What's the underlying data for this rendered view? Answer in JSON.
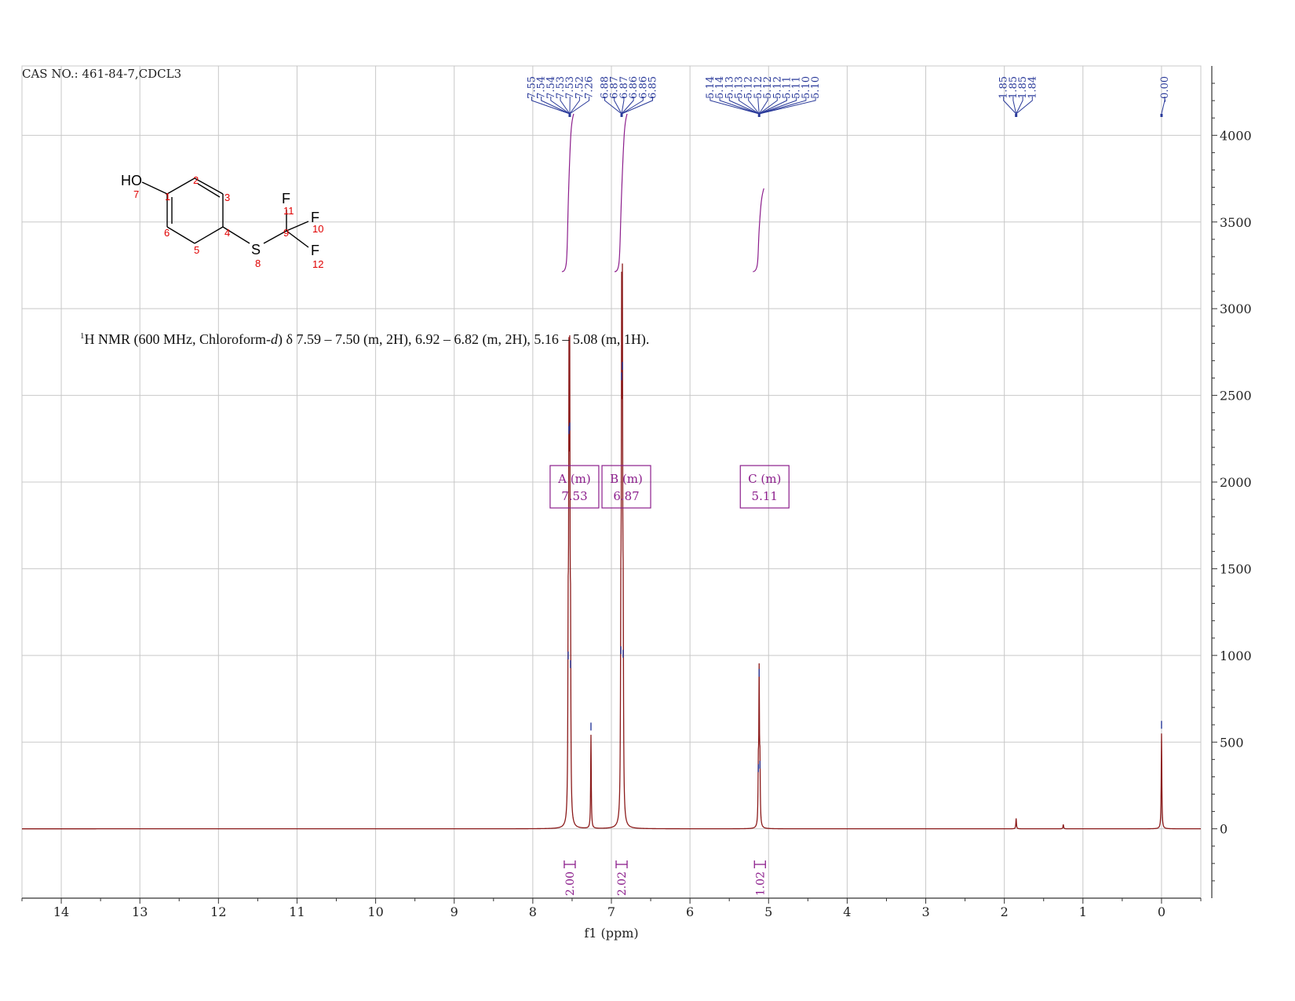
{
  "header": {
    "cas_text": "CAS NO.: 461-84-7,CDCL3",
    "nmr_summary_sup": "1",
    "nmr_summary_a": "H NMR (600 MHz, Chloroform-",
    "nmr_summary_italic": "d",
    "nmr_summary_b": ") δ 7.59 – 7.50 (m, 2H), 6.92 – 6.82 (m, 2H), 5.16 – 5.08 (m, 1H)."
  },
  "structure": {
    "atoms": {
      "ho": "HO",
      "s": "S",
      "f11": "F",
      "f10": "F",
      "f12": "F"
    },
    "numbers": {
      "n1": "1",
      "n2": "2",
      "n3": "3",
      "n4": "4",
      "n5": "5",
      "n6": "6",
      "n7": "7",
      "n8": "8",
      "n9": "9",
      "n10": "10",
      "n11": "11",
      "n12": "12"
    }
  },
  "chart_data": {
    "type": "line",
    "xlabel": "f1 (ppm)",
    "ylabel": "",
    "xlim": [
      14.5,
      -0.5
    ],
    "ylim": [
      -400,
      4400
    ],
    "x_ticks": [
      "14",
      "13",
      "12",
      "11",
      "10",
      "9",
      "8",
      "7",
      "6",
      "5",
      "4",
      "3",
      "2",
      "1",
      "0"
    ],
    "y_ticks": [
      "4000",
      "3500",
      "3000",
      "2500",
      "2000",
      "1500",
      "1000",
      "500",
      "0"
    ],
    "grid": true,
    "colors": {
      "spectrum": "#8b1a1a",
      "peak_labels": "#2a3a9a",
      "integral": "#8c1e8c",
      "grid": "#c8c8c8",
      "axis": "#333333"
    },
    "peaks": [
      {
        "ppm": 7.55,
        "height": 950
      },
      {
        "ppm": 7.54,
        "height": 2250
      },
      {
        "ppm": 7.53,
        "height": 2270
      },
      {
        "ppm": 7.52,
        "height": 900
      },
      {
        "ppm": 7.26,
        "height": 540
      },
      {
        "ppm": 6.88,
        "height": 980
      },
      {
        "ppm": 6.87,
        "height": 2560
      },
      {
        "ppm": 6.86,
        "height": 2620
      },
      {
        "ppm": 6.85,
        "height": 960
      },
      {
        "ppm": 5.12,
        "height": 850
      },
      {
        "ppm": 5.11,
        "height": 320
      },
      {
        "ppm": 5.13,
        "height": 300
      },
      {
        "ppm": 1.85,
        "height": 60
      },
      {
        "ppm": 1.25,
        "height": 25
      },
      {
        "ppm": 0.0,
        "height": 550
      }
    ],
    "peak_label_groups": [
      {
        "labels": [
          "7.55",
          "7.54",
          "7.54",
          "7.53",
          "7.53",
          "7.52",
          "7.26"
        ],
        "target_ppm": 7.53
      },
      {
        "labels": [
          "6.88",
          "6.87",
          "6.87",
          "6.86",
          "6.86",
          "6.85"
        ],
        "target_ppm": 6.87
      },
      {
        "labels": [
          "5.14",
          "5.14",
          "5.13",
          "5.13",
          "5.12",
          "5.12",
          "5.12",
          "5.12",
          "5.11",
          "5.11",
          "5.10",
          "5.10"
        ],
        "target_ppm": 5.12
      },
      {
        "labels": [
          "1.85",
          "1.85",
          "1.85",
          "1.84"
        ],
        "target_ppm": 1.85
      },
      {
        "labels": [
          "-0.00"
        ],
        "target_ppm": 0.0
      }
    ],
    "multiplets": [
      {
        "letter": "A",
        "type": "(m)",
        "shift": "7.53",
        "ppm": 7.53
      },
      {
        "letter": "B",
        "type": "(m)",
        "shift": "6.87",
        "ppm": 6.87
      },
      {
        "letter": "C",
        "type": "(m)",
        "shift": "5.11",
        "ppm": 5.11
      }
    ],
    "integrals": [
      {
        "value": "2.00",
        "ppm": 7.53,
        "from": 7.59,
        "to": 7.5
      },
      {
        "value": "2.02",
        "ppm": 6.87,
        "from": 6.92,
        "to": 6.82
      },
      {
        "value": "1.02",
        "ppm": 5.11,
        "from": 5.16,
        "to": 5.08
      }
    ]
  }
}
